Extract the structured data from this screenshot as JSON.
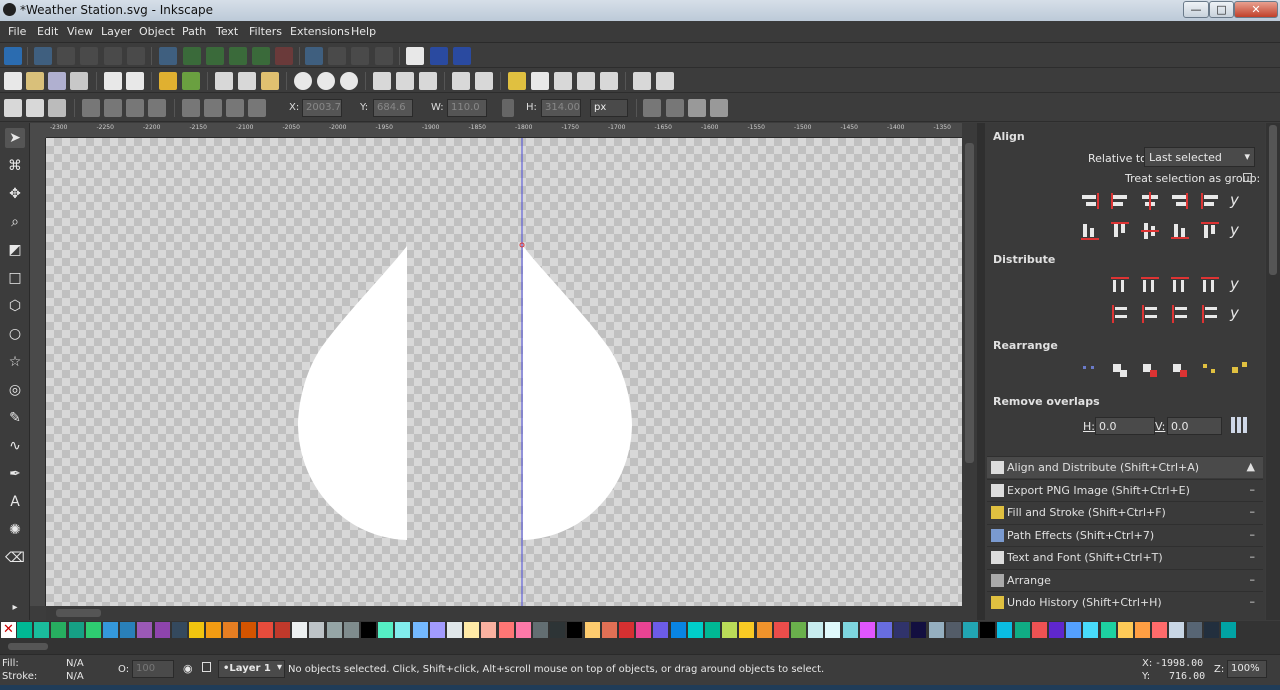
{
  "window": {
    "title": "*Weather Station.svg - Inkscape",
    "min": "—",
    "max": "□",
    "close": "✕"
  },
  "menu": [
    "File",
    "Edit",
    "View",
    "Layer",
    "Object",
    "Path",
    "Text",
    "Filters",
    "Extensions",
    "Help"
  ],
  "tool_controls": {
    "x_label": "X:",
    "x_value": "2003.7",
    "y_label": "Y:",
    "y_value": "684.6",
    "w_label": "W:",
    "w_value": "110.0",
    "h_label": "H:",
    "h_value": "314.00",
    "unit": "px"
  },
  "ruler_ticks": [
    "-2300",
    "-2250",
    "-2200",
    "-2150",
    "-2100",
    "-2050",
    "-2000",
    "-1950",
    "-1900",
    "-1850",
    "-1800",
    "-1750",
    "-1700",
    "-1650",
    "-1600",
    "-1550",
    "-1500",
    "-1450",
    "-1400",
    "-1350"
  ],
  "align_panel": {
    "title": "Align",
    "relative_label": "Relative to:",
    "relative_value": "Last selected",
    "treat_group_label": "Treat selection as group:",
    "distribute": "Distribute",
    "rearrange": "Rearrange",
    "remove_overlaps": "Remove overlaps",
    "h_label": "H:",
    "h_value": "0.0",
    "v_label": "V:",
    "v_value": "0.0"
  },
  "dock_tabs": [
    {
      "label": "Align and Distribute (Shift+Ctrl+A)",
      "mark": "▲",
      "icon": "align-icon"
    },
    {
      "label": "Export PNG Image (Shift+Ctrl+E)",
      "mark": "–",
      "icon": "export-icon"
    },
    {
      "label": "Fill and Stroke (Shift+Ctrl+F)",
      "mark": "–",
      "icon": "fill-stroke-icon"
    },
    {
      "label": "Path Effects  (Shift+Ctrl+7)",
      "mark": "–",
      "icon": "path-effects-icon"
    },
    {
      "label": "Text and Font (Shift+Ctrl+T)",
      "mark": "–",
      "icon": "text-font-icon"
    },
    {
      "label": "Arrange",
      "mark": "–",
      "icon": "arrange-icon"
    },
    {
      "label": "Undo History (Shift+Ctrl+H)",
      "mark": "–",
      "icon": "undo-history-icon"
    }
  ],
  "palette": [
    "#00b894",
    "#1abc9c",
    "#27ae60",
    "#16a085",
    "#2ecc71",
    "#3498db",
    "#2980b9",
    "#9b59b6",
    "#8e44ad",
    "#34495e",
    "#f1c40f",
    "#f39c12",
    "#e67e22",
    "#d35400",
    "#e74c3c",
    "#c0392b",
    "#ecf0f1",
    "#bdc3c7",
    "#95a5a6",
    "#7f8c8d",
    "#000000",
    "#55efc4",
    "#81ecec",
    "#74b9ff",
    "#a29bfe",
    "#dfe6e9",
    "#ffeaa7",
    "#fab1a0",
    "#ff7675",
    "#fd79a8",
    "#636e72",
    "#2d3436",
    "#000000",
    "#fdcb6e",
    "#e17055",
    "#d63031",
    "#e84393",
    "#6c5ce7",
    "#0984e3",
    "#00cec9",
    "#00b894",
    "#badc58",
    "#f9ca24",
    "#f0932b",
    "#eb4d4b",
    "#6ab04c",
    "#c7ecee",
    "#dff9fb",
    "#7ed6df",
    "#e056fd",
    "#686de0",
    "#30336b",
    "#130f40",
    "#95afc0",
    "#535c68",
    "#22a6b3",
    "#000000",
    "#0abde3",
    "#10ac84",
    "#ee5253",
    "#5f27cd",
    "#54a0ff",
    "#48dbfb",
    "#1dd1a1",
    "#feca57",
    "#ff9f43",
    "#ff6b6b",
    "#c8d6e5",
    "#576574",
    "#222f3e",
    "#01a3a4"
  ],
  "status": {
    "fill_label": "Fill:",
    "fill_value": "N/A",
    "stroke_label": "Stroke:",
    "stroke_value": "N/A",
    "opacity_label": "O:",
    "opacity_value": "100",
    "layer": "•Layer 1",
    "message": "No objects selected. Click, Shift+click, Alt+scroll mouse on top of objects, or drag around objects to select.",
    "x_label": "X:",
    "x_value": "-1998.00",
    "y_label": "Y:",
    "y_value": "716.00",
    "zoom_label": "Z:",
    "zoom_value": "100%"
  }
}
